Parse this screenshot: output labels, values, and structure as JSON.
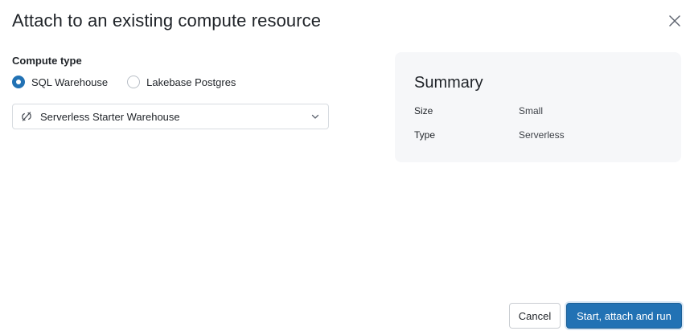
{
  "dialog": {
    "title": "Attach to an existing compute resource",
    "close_icon": "close-icon"
  },
  "compute": {
    "label": "Compute type",
    "options": [
      {
        "label": "SQL Warehouse",
        "selected": true
      },
      {
        "label": "Lakebase Postgres",
        "selected": false
      }
    ],
    "select": {
      "value": "Serverless Starter Warehouse",
      "icon": "serverless-icon",
      "chevron": "chevron-down-icon"
    }
  },
  "summary": {
    "title": "Summary",
    "rows": [
      {
        "key": "Size",
        "value": "Small"
      },
      {
        "key": "Type",
        "value": "Serverless"
      }
    ]
  },
  "footer": {
    "cancel_label": "Cancel",
    "primary_label": "Start, attach and run"
  },
  "colors": {
    "accent": "#2272b4",
    "summary_bg": "#f6f7f9",
    "text": "#1f2328"
  }
}
